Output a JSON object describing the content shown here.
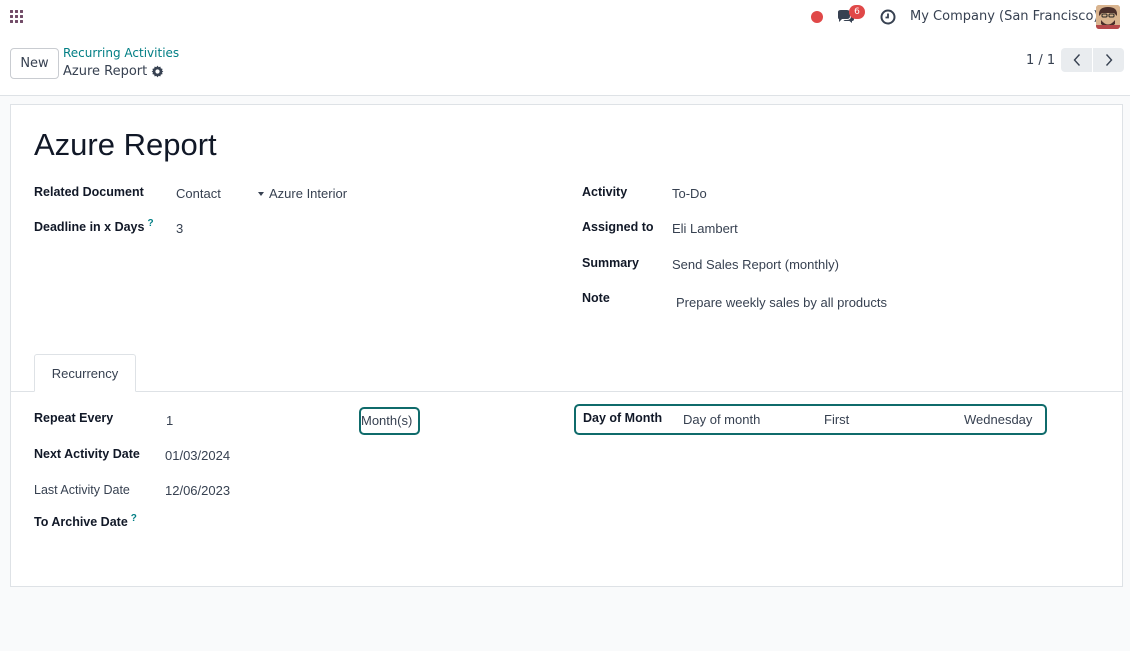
{
  "navbar": {
    "apps_icon": "apps-grid-icon",
    "chat_icon": "chat-icon",
    "message_count": "6",
    "activity_icon": "clock-icon",
    "company": "My Company (San Francisco)",
    "status_color": "#e04848"
  },
  "control": {
    "new_label": "New",
    "breadcrumb_parent": "Recurring Activities",
    "record_name": "Azure Report",
    "gear_icon": "gear-icon",
    "pager_value": "1 / 1"
  },
  "form": {
    "title": "Azure Report",
    "related_document_label": "Related Document",
    "related_document_model": "Contact",
    "related_document_record": "Azure Interior",
    "deadline_label": "Deadline in x Days",
    "deadline_help": "?",
    "deadline_value": "3",
    "activity_label": "Activity",
    "activity_value": "To-Do",
    "assigned_label": "Assigned to",
    "assigned_value": "Eli Lambert",
    "summary_label": "Summary",
    "summary_value": "Send Sales Report (monthly)",
    "note_label": "Note",
    "note_value": "Prepare weekly sales by all products"
  },
  "tabs": {
    "recurrency_label": "Recurrency"
  },
  "recurrency": {
    "repeat_every_label": "Repeat Every",
    "repeat_every_value": "1",
    "repeat_unit": "Month(s)",
    "day_of_month_label": "Day of Month",
    "day_mode": "Day of month",
    "week_position": "First",
    "weekday": "Wednesday",
    "next_date_label": "Next Activity Date",
    "next_date_value": "01/03/2024",
    "last_date_label": "Last Activity Date",
    "last_date_value": "12/06/2023",
    "archive_label": "To Archive Date",
    "archive_help": "?"
  },
  "colors": {
    "accent": "#017e84",
    "brand": "#714b67",
    "highlight_border": "#0f6b6b",
    "badge": "#e04848"
  }
}
